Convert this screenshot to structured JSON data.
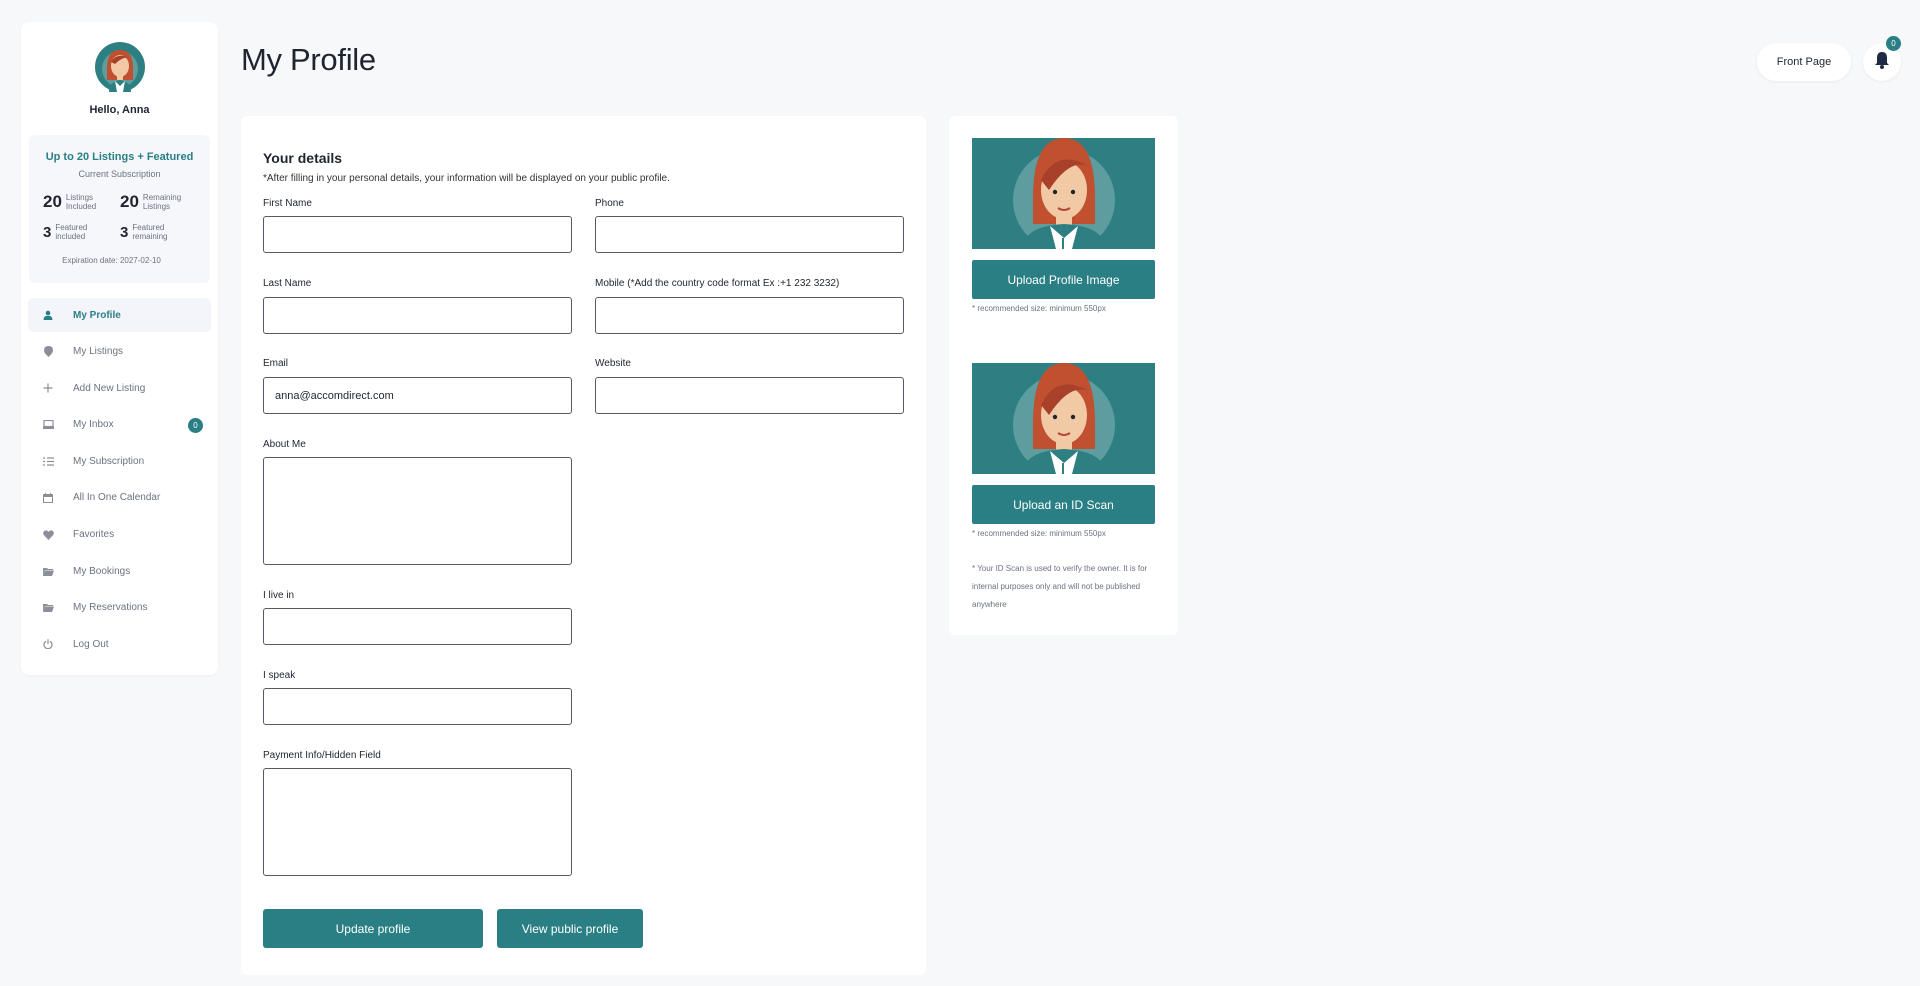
{
  "sidebar": {
    "greeting": "Hello, Anna",
    "subscription": {
      "plan": "Up to 20 Listings + Featured",
      "caption": "Current Subscription",
      "stats": [
        {
          "value": "20",
          "label": "Listings Included"
        },
        {
          "value": "20",
          "label": "Remaining Listings"
        },
        {
          "value": "3",
          "label": "Featured included"
        },
        {
          "value": "3",
          "label": "Featured remaining"
        }
      ],
      "expiration": "Expiration date: 2027-02-10"
    },
    "items": [
      {
        "label": "My Profile",
        "icon": "user-icon"
      },
      {
        "label": "My Listings",
        "icon": "map-pin-icon"
      },
      {
        "label": "Add New Listing",
        "icon": "plus-icon"
      },
      {
        "label": "My Inbox",
        "icon": "inbox-icon",
        "badge": "0"
      },
      {
        "label": "My Subscription",
        "icon": "list-icon"
      },
      {
        "label": "All In One Calendar",
        "icon": "calendar-icon"
      },
      {
        "label": "Favorites",
        "icon": "heart-icon"
      },
      {
        "label": "My Bookings",
        "icon": "folder-icon"
      },
      {
        "label": "My Reservations",
        "icon": "folder-icon"
      },
      {
        "label": "Log Out",
        "icon": "power-icon"
      }
    ]
  },
  "header": {
    "title": "My Profile",
    "front_page": "Front Page",
    "notification_count": "0"
  },
  "form": {
    "title": "Your details",
    "note": "*After filling in your personal details, your information will be displayed on your public profile.",
    "first_name": {
      "label": "First Name",
      "value": ""
    },
    "phone": {
      "label": "Phone",
      "value": ""
    },
    "last_name": {
      "label": "Last Name",
      "value": ""
    },
    "mobile": {
      "label": "Mobile (*Add the country code format Ex :+1 232 3232)",
      "value": ""
    },
    "email": {
      "label": "Email",
      "value": "anna@accomdirect.com"
    },
    "website": {
      "label": "Website",
      "value": ""
    },
    "about": {
      "label": "About Me",
      "value": ""
    },
    "live_in": {
      "label": "I live in",
      "value": ""
    },
    "speak": {
      "label": "I speak",
      "value": ""
    },
    "payment": {
      "label": "Payment Info/Hidden Field",
      "value": ""
    },
    "update_button": "Update profile",
    "public_button": "View public profile"
  },
  "uploads": {
    "profile_button": "Upload Profile Image",
    "profile_rec": "* recommended size: minimum 550px",
    "id_button": "Upload an ID Scan",
    "id_rec": "* recommended size: minimum 550px",
    "id_note": "* Your ID Scan is used to verify the owner. It is for internal purposes only and will not be published anywhere"
  },
  "colors": {
    "accent": "#2a7f84",
    "background": "#f7f8fa"
  }
}
